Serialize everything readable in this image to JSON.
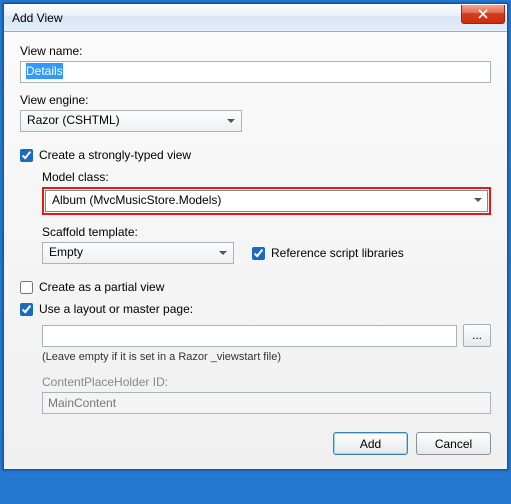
{
  "titlebar": {
    "title": "Add View"
  },
  "viewName": {
    "label": "View name:",
    "value": "Details"
  },
  "viewEngine": {
    "label": "View engine:",
    "value": "Razor (CSHTML)"
  },
  "stronglyTyped": {
    "checkboxLabel": "Create a strongly-typed view",
    "checked": true,
    "modelClass": {
      "label": "Model class:",
      "value": "Album (MvcMusicStore.Models)"
    },
    "scaffold": {
      "label": "Scaffold template:",
      "value": "Empty"
    },
    "referenceScripts": {
      "label": "Reference script libraries",
      "checked": true
    }
  },
  "partialView": {
    "label": "Create as a partial view",
    "checked": false
  },
  "layout": {
    "checkboxLabel": "Use a layout or master page:",
    "checked": true,
    "path": "",
    "browse": "...",
    "hint": "(Leave empty if it is set in a Razor _viewstart file)",
    "cph": {
      "label": "ContentPlaceHolder ID:",
      "value": "MainContent"
    }
  },
  "buttons": {
    "add": "Add",
    "cancel": "Cancel"
  }
}
